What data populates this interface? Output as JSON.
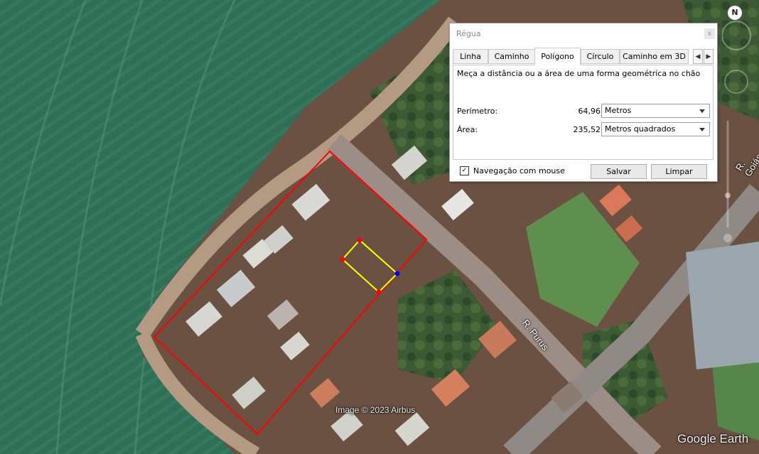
{
  "dialog": {
    "title": "Régua",
    "close_symbol": "x",
    "tabs": [
      {
        "label": "Linha"
      },
      {
        "label": "Caminho"
      },
      {
        "label": "Polígono"
      },
      {
        "label": "Círculo"
      },
      {
        "label": "Caminho em 3D"
      }
    ],
    "active_tab": "Polígono",
    "description": "Meça a distância ou a área de uma forma geométrica no chão",
    "perimeter": {
      "label": "Perímetro:",
      "value": "64,96",
      "unit": "Metros"
    },
    "area": {
      "label": "Área:",
      "value": "235,52",
      "unit": "Metros quadrados"
    },
    "mouse_navigation": {
      "label": "Navegação com mouse",
      "checked": true,
      "check_symbol": "✓"
    },
    "save_button": "Salvar",
    "clear_button": "Limpar",
    "arrow_left": "◀",
    "arrow_right": "▶"
  },
  "map": {
    "road_labels": [
      "R. Purus",
      "R. Goiás"
    ],
    "attribution": "Image © 2023 Airbus",
    "brand": "Google Earth",
    "compass_letter": "N",
    "colors": {
      "property_outline": "#ff0000",
      "measured_polygon": "#ffff00",
      "vertex": "#ff0000",
      "active_vertex": "#0000ff"
    }
  }
}
